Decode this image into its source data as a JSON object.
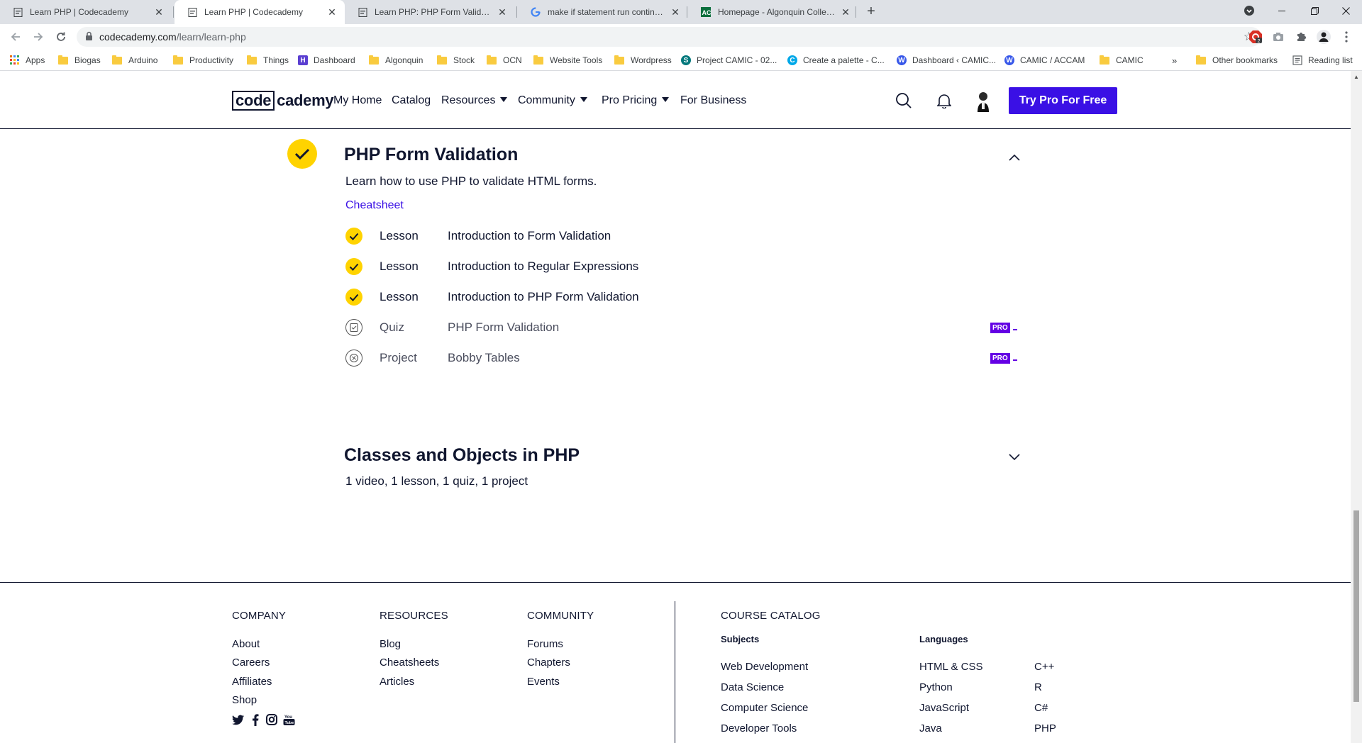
{
  "browser": {
    "tabs": [
      {
        "title": "Learn PHP | Codecademy",
        "active": false
      },
      {
        "title": "Learn PHP | Codecademy",
        "active": true
      },
      {
        "title": "Learn PHP: PHP Form Validation | Codecademy",
        "active": false
      },
      {
        "title": "make if statement run continuously",
        "active": false
      },
      {
        "title": "Homepage - Algonquin College",
        "active": false
      }
    ],
    "url_host": "codecademy.com",
    "url_path": "/learn/learn-php",
    "bookmarks": [
      "Apps",
      "Biogas",
      "Arduino",
      "Productivity",
      "Things",
      "Dashboard",
      "Algonquin",
      "Stock",
      "OCN",
      "Website Tools",
      "Wordpress",
      "Project CAMIC - 02...",
      "Create a palette - C...",
      "Dashboard ‹ CAMIC...",
      "CAMIC / ACCAM",
      "CAMIC",
      "»",
      "Other bookmarks",
      "Reading list"
    ],
    "extension_badge": "2"
  },
  "header": {
    "logo_box": "code",
    "logo_rest": "cademy",
    "nav": [
      "My Home",
      "Catalog",
      "Resources",
      "Community",
      "Pro Pricing",
      "For Business"
    ],
    "cta": "Try Pro For Free"
  },
  "module1": {
    "title": "PHP Form Validation",
    "description": "Learn how to use PHP to validate HTML forms.",
    "cheatsheet": "Cheatsheet",
    "items": [
      {
        "kind": "Lesson",
        "name": "Introduction to Form Validation",
        "done": true,
        "pro": false
      },
      {
        "kind": "Lesson",
        "name": "Introduction to Regular Expressions",
        "done": true,
        "pro": false
      },
      {
        "kind": "Lesson",
        "name": "Introduction to PHP Form Validation",
        "done": true,
        "pro": false
      },
      {
        "kind": "Quiz",
        "name": "PHP Form Validation",
        "done": false,
        "pro": true
      },
      {
        "kind": "Project",
        "name": "Bobby Tables",
        "done": false,
        "pro": true
      }
    ],
    "pro_label": "PRO"
  },
  "module2": {
    "title": "Classes and Objects in PHP",
    "summary": "1 video, 1 lesson, 1 quiz, 1 project"
  },
  "footer": {
    "company": {
      "heading": "COMPANY",
      "links": [
        "About",
        "Careers",
        "Affiliates",
        "Shop"
      ]
    },
    "resources": {
      "heading": "RESOURCES",
      "links": [
        "Blog",
        "Cheatsheets",
        "Articles"
      ]
    },
    "community": {
      "heading": "COMMUNITY",
      "links": [
        "Forums",
        "Chapters",
        "Events"
      ]
    },
    "catalog": {
      "heading": "COURSE CATALOG",
      "subjects_heading": "Subjects",
      "subjects": [
        "Web Development",
        "Data Science",
        "Computer Science",
        "Developer Tools"
      ],
      "languages_heading": "Languages",
      "languages_col1": [
        "HTML & CSS",
        "Python",
        "JavaScript",
        "Java"
      ],
      "languages_col2": [
        "C++",
        "R",
        "C#",
        "PHP"
      ]
    },
    "social_icons": [
      "twitter-icon",
      "facebook-icon",
      "instagram-icon",
      "youtube-icon"
    ]
  },
  "colors": {
    "brand_purple": "#3a10e5",
    "check_yellow": "#ffd300",
    "navy": "#10162f",
    "pro_purple": "#6400e4"
  }
}
